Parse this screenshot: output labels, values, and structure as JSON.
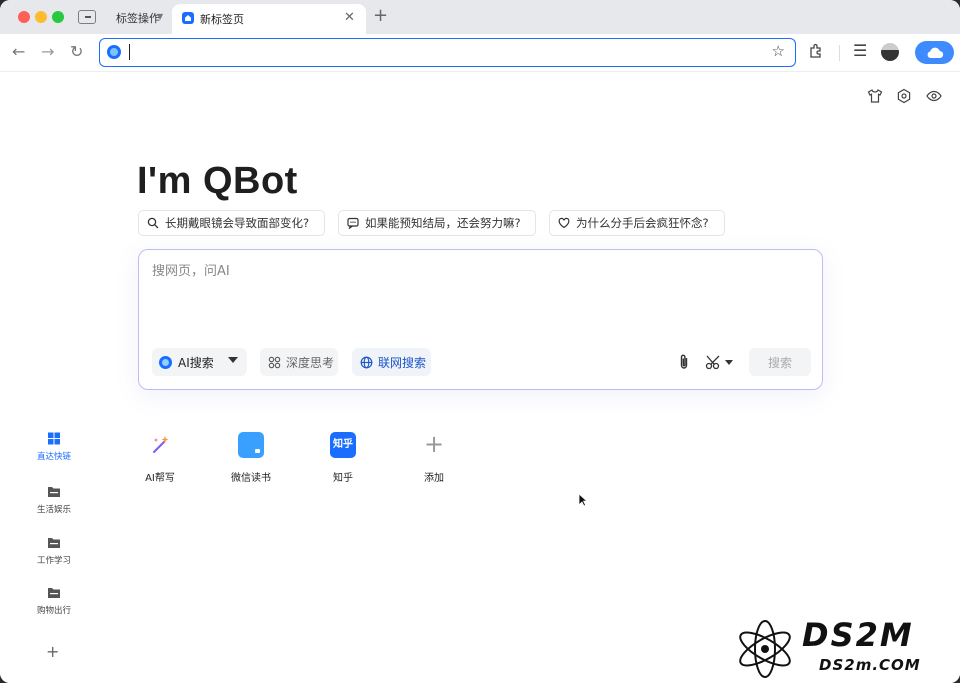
{
  "tabstrip": {
    "group_label": "标签操作",
    "active_tab_title": "新标签页"
  },
  "toolbar": {
    "address_value": ""
  },
  "hero": {
    "title": "I'm QBot"
  },
  "suggestions": [
    {
      "label": "长期戴眼镜会导致面部变化?",
      "icon": "search-icon"
    },
    {
      "label": "如果能预知结局，还会努力嘛?",
      "icon": "chat-icon"
    },
    {
      "label": "为什么分手后会疯狂怀念?",
      "icon": "heart-icon"
    }
  ],
  "search": {
    "placeholder": "搜网页，问AI",
    "mode_label": "AI搜索",
    "deep_think_label": "深度思考",
    "web_search_label": "联网搜索",
    "submit_label": "搜索"
  },
  "sidebar": {
    "items": [
      {
        "label": "直达快链",
        "active": true,
        "icon": "grid-icon"
      },
      {
        "label": "生活娱乐",
        "active": false,
        "icon": "folder-icon"
      },
      {
        "label": "工作学习",
        "active": false,
        "icon": "folder-icon"
      },
      {
        "label": "购物出行",
        "active": false,
        "icon": "folder-icon"
      }
    ]
  },
  "shortcuts": [
    {
      "label": "AI帮写",
      "icon": "magic-wand-icon"
    },
    {
      "label": "微信读书",
      "icon": "weread-icon"
    },
    {
      "label": "知乎",
      "icon": "zhihu-icon",
      "logo_text": "知乎"
    },
    {
      "label": "添加",
      "icon": "plus-icon"
    }
  ],
  "watermark": {
    "main": "DS2M",
    "sub": "DS2m.COM"
  },
  "colors": {
    "accent": "#1a6dff",
    "search_border": "#b9bff5",
    "cloud_button": "#3d8bff"
  }
}
